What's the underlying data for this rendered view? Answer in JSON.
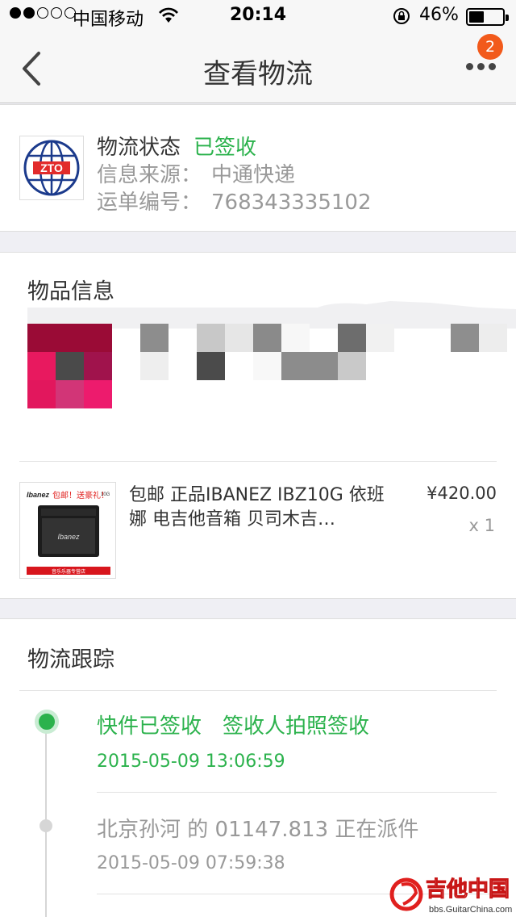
{
  "status_bar": {
    "carrier": "中国移动",
    "time": "20:14",
    "battery": "46%",
    "battery_level": 0.46
  },
  "nav": {
    "title": "查看物流",
    "back_icon": "chevron-left-icon",
    "more_icon": "more-dots-icon",
    "badge": "2"
  },
  "logistics": {
    "logo_text": "ZTO",
    "status_label": "物流状态",
    "status_value": "已签收",
    "source_label": "信息来源：",
    "source_value": "中通快递",
    "waybill_label": "运单编号：",
    "waybill_value": "768343335102"
  },
  "goods": {
    "section_title": "物品信息",
    "product": {
      "title": "包邮 正品IBANEZ IBZ10G 依班娜 电吉他音箱 贝司木吉…",
      "price": "¥420.00",
      "qty": "x 1",
      "thumb_brand": "Ibanez",
      "thumb_promo": "包邮！送豪礼！",
      "thumb_model": "10G",
      "thumb_footer": "音乐乐器专营店"
    }
  },
  "tracking": {
    "section_title": "物流跟踪",
    "events": [
      {
        "text": "快件已签收　签收人拍照签收",
        "time": "2015-05-09 13:06:59",
        "active": true
      },
      {
        "text": "北京孙河 的 01147.813 正在派件",
        "time": "2015-05-09 07:59:38",
        "active": false
      }
    ]
  },
  "watermark": {
    "title": "吉他中国",
    "url": "bbs.GuitarChina.com"
  },
  "colors": {
    "accent_green": "#2bb24c",
    "badge_orange": "#f25a1b"
  }
}
